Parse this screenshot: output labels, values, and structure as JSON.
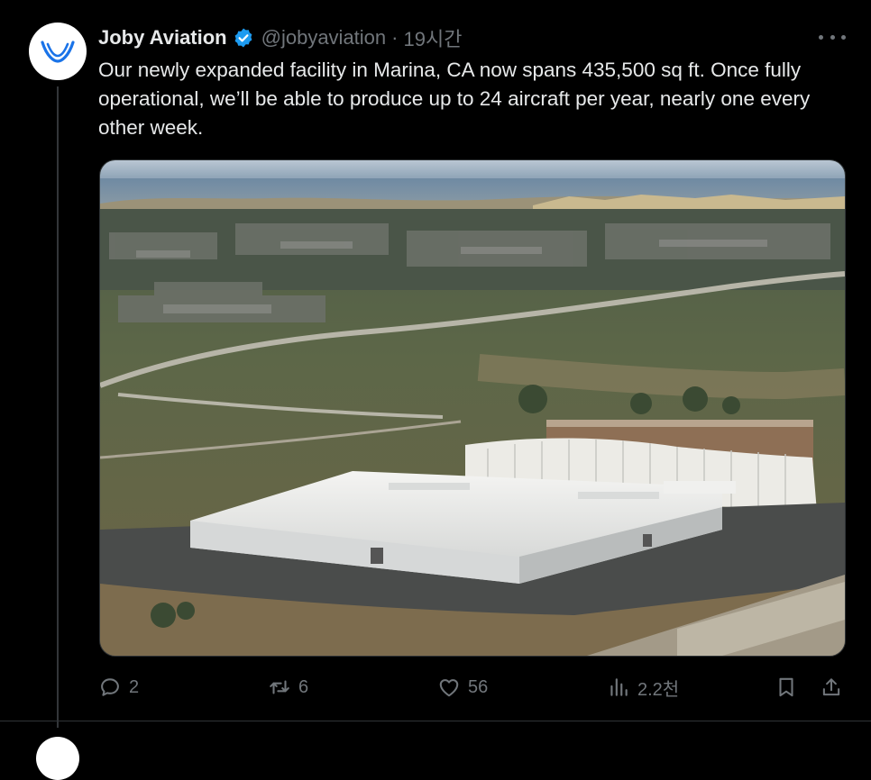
{
  "tweet": {
    "author_name": "Joby Aviation",
    "handle": "@jobyaviation",
    "separator": "·",
    "timestamp": "19시간",
    "text": "Our newly expanded facility in Marina, CA now spans 435,500 sq ft. Once fully operational, we’ll be able to produce up to 24 aircraft per year, nearly one every other week.",
    "verified": true
  },
  "actions": {
    "reply_count": "2",
    "repost_count": "6",
    "like_count": "56",
    "views_count": "2.2천"
  },
  "icons": {
    "avatar": "joby-logo",
    "verified": "verified-badge-icon",
    "more": "more-icon",
    "reply": "reply-icon",
    "repost": "repost-icon",
    "like": "heart-icon",
    "views": "views-icon",
    "bookmark": "bookmark-icon",
    "share": "share-icon"
  },
  "colors": {
    "background": "#000000",
    "text": "#e7e9ea",
    "muted": "#71767b",
    "verified": "#1d9bf0",
    "brand": "#1a73e8"
  }
}
